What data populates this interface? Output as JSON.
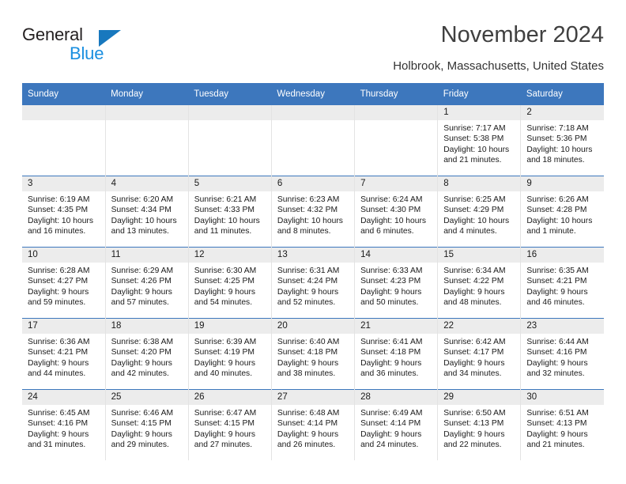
{
  "brand": {
    "name_part1": "General",
    "name_part2": "Blue",
    "triangle_color": "#1878be",
    "blue_color": "#1a8fe0"
  },
  "header": {
    "title": "November 2024",
    "location": "Holbrook, Massachusetts, United States"
  },
  "theme": {
    "header_blue": "#3d77bd",
    "daynum_gray": "#ececec",
    "grid_line": "#e3e3e3"
  },
  "weekday_headers": [
    "Sunday",
    "Monday",
    "Tuesday",
    "Wednesday",
    "Thursday",
    "Friday",
    "Saturday"
  ],
  "weeks": [
    [
      {
        "day": "",
        "sunrise": "",
        "sunset": "",
        "daylight_line1": "",
        "daylight_line2": "",
        "empty": true
      },
      {
        "day": "",
        "sunrise": "",
        "sunset": "",
        "daylight_line1": "",
        "daylight_line2": "",
        "empty": true
      },
      {
        "day": "",
        "sunrise": "",
        "sunset": "",
        "daylight_line1": "",
        "daylight_line2": "",
        "empty": true
      },
      {
        "day": "",
        "sunrise": "",
        "sunset": "",
        "daylight_line1": "",
        "daylight_line2": "",
        "empty": true
      },
      {
        "day": "",
        "sunrise": "",
        "sunset": "",
        "daylight_line1": "",
        "daylight_line2": "",
        "empty": true
      },
      {
        "day": "1",
        "sunrise": "Sunrise: 7:17 AM",
        "sunset": "Sunset: 5:38 PM",
        "daylight_line1": "Daylight: 10 hours",
        "daylight_line2": "and 21 minutes.",
        "empty": false
      },
      {
        "day": "2",
        "sunrise": "Sunrise: 7:18 AM",
        "sunset": "Sunset: 5:36 PM",
        "daylight_line1": "Daylight: 10 hours",
        "daylight_line2": "and 18 minutes.",
        "empty": false
      }
    ],
    [
      {
        "day": "3",
        "sunrise": "Sunrise: 6:19 AM",
        "sunset": "Sunset: 4:35 PM",
        "daylight_line1": "Daylight: 10 hours",
        "daylight_line2": "and 16 minutes.",
        "empty": false
      },
      {
        "day": "4",
        "sunrise": "Sunrise: 6:20 AM",
        "sunset": "Sunset: 4:34 PM",
        "daylight_line1": "Daylight: 10 hours",
        "daylight_line2": "and 13 minutes.",
        "empty": false
      },
      {
        "day": "5",
        "sunrise": "Sunrise: 6:21 AM",
        "sunset": "Sunset: 4:33 PM",
        "daylight_line1": "Daylight: 10 hours",
        "daylight_line2": "and 11 minutes.",
        "empty": false
      },
      {
        "day": "6",
        "sunrise": "Sunrise: 6:23 AM",
        "sunset": "Sunset: 4:32 PM",
        "daylight_line1": "Daylight: 10 hours",
        "daylight_line2": "and 8 minutes.",
        "empty": false
      },
      {
        "day": "7",
        "sunrise": "Sunrise: 6:24 AM",
        "sunset": "Sunset: 4:30 PM",
        "daylight_line1": "Daylight: 10 hours",
        "daylight_line2": "and 6 minutes.",
        "empty": false
      },
      {
        "day": "8",
        "sunrise": "Sunrise: 6:25 AM",
        "sunset": "Sunset: 4:29 PM",
        "daylight_line1": "Daylight: 10 hours",
        "daylight_line2": "and 4 minutes.",
        "empty": false
      },
      {
        "day": "9",
        "sunrise": "Sunrise: 6:26 AM",
        "sunset": "Sunset: 4:28 PM",
        "daylight_line1": "Daylight: 10 hours",
        "daylight_line2": "and 1 minute.",
        "empty": false
      }
    ],
    [
      {
        "day": "10",
        "sunrise": "Sunrise: 6:28 AM",
        "sunset": "Sunset: 4:27 PM",
        "daylight_line1": "Daylight: 9 hours",
        "daylight_line2": "and 59 minutes.",
        "empty": false
      },
      {
        "day": "11",
        "sunrise": "Sunrise: 6:29 AM",
        "sunset": "Sunset: 4:26 PM",
        "daylight_line1": "Daylight: 9 hours",
        "daylight_line2": "and 57 minutes.",
        "empty": false
      },
      {
        "day": "12",
        "sunrise": "Sunrise: 6:30 AM",
        "sunset": "Sunset: 4:25 PM",
        "daylight_line1": "Daylight: 9 hours",
        "daylight_line2": "and 54 minutes.",
        "empty": false
      },
      {
        "day": "13",
        "sunrise": "Sunrise: 6:31 AM",
        "sunset": "Sunset: 4:24 PM",
        "daylight_line1": "Daylight: 9 hours",
        "daylight_line2": "and 52 minutes.",
        "empty": false
      },
      {
        "day": "14",
        "sunrise": "Sunrise: 6:33 AM",
        "sunset": "Sunset: 4:23 PM",
        "daylight_line1": "Daylight: 9 hours",
        "daylight_line2": "and 50 minutes.",
        "empty": false
      },
      {
        "day": "15",
        "sunrise": "Sunrise: 6:34 AM",
        "sunset": "Sunset: 4:22 PM",
        "daylight_line1": "Daylight: 9 hours",
        "daylight_line2": "and 48 minutes.",
        "empty": false
      },
      {
        "day": "16",
        "sunrise": "Sunrise: 6:35 AM",
        "sunset": "Sunset: 4:21 PM",
        "daylight_line1": "Daylight: 9 hours",
        "daylight_line2": "and 46 minutes.",
        "empty": false
      }
    ],
    [
      {
        "day": "17",
        "sunrise": "Sunrise: 6:36 AM",
        "sunset": "Sunset: 4:21 PM",
        "daylight_line1": "Daylight: 9 hours",
        "daylight_line2": "and 44 minutes.",
        "empty": false
      },
      {
        "day": "18",
        "sunrise": "Sunrise: 6:38 AM",
        "sunset": "Sunset: 4:20 PM",
        "daylight_line1": "Daylight: 9 hours",
        "daylight_line2": "and 42 minutes.",
        "empty": false
      },
      {
        "day": "19",
        "sunrise": "Sunrise: 6:39 AM",
        "sunset": "Sunset: 4:19 PM",
        "daylight_line1": "Daylight: 9 hours",
        "daylight_line2": "and 40 minutes.",
        "empty": false
      },
      {
        "day": "20",
        "sunrise": "Sunrise: 6:40 AM",
        "sunset": "Sunset: 4:18 PM",
        "daylight_line1": "Daylight: 9 hours",
        "daylight_line2": "and 38 minutes.",
        "empty": false
      },
      {
        "day": "21",
        "sunrise": "Sunrise: 6:41 AM",
        "sunset": "Sunset: 4:18 PM",
        "daylight_line1": "Daylight: 9 hours",
        "daylight_line2": "and 36 minutes.",
        "empty": false
      },
      {
        "day": "22",
        "sunrise": "Sunrise: 6:42 AM",
        "sunset": "Sunset: 4:17 PM",
        "daylight_line1": "Daylight: 9 hours",
        "daylight_line2": "and 34 minutes.",
        "empty": false
      },
      {
        "day": "23",
        "sunrise": "Sunrise: 6:44 AM",
        "sunset": "Sunset: 4:16 PM",
        "daylight_line1": "Daylight: 9 hours",
        "daylight_line2": "and 32 minutes.",
        "empty": false
      }
    ],
    [
      {
        "day": "24",
        "sunrise": "Sunrise: 6:45 AM",
        "sunset": "Sunset: 4:16 PM",
        "daylight_line1": "Daylight: 9 hours",
        "daylight_line2": "and 31 minutes.",
        "empty": false
      },
      {
        "day": "25",
        "sunrise": "Sunrise: 6:46 AM",
        "sunset": "Sunset: 4:15 PM",
        "daylight_line1": "Daylight: 9 hours",
        "daylight_line2": "and 29 minutes.",
        "empty": false
      },
      {
        "day": "26",
        "sunrise": "Sunrise: 6:47 AM",
        "sunset": "Sunset: 4:15 PM",
        "daylight_line1": "Daylight: 9 hours",
        "daylight_line2": "and 27 minutes.",
        "empty": false
      },
      {
        "day": "27",
        "sunrise": "Sunrise: 6:48 AM",
        "sunset": "Sunset: 4:14 PM",
        "daylight_line1": "Daylight: 9 hours",
        "daylight_line2": "and 26 minutes.",
        "empty": false
      },
      {
        "day": "28",
        "sunrise": "Sunrise: 6:49 AM",
        "sunset": "Sunset: 4:14 PM",
        "daylight_line1": "Daylight: 9 hours",
        "daylight_line2": "and 24 minutes.",
        "empty": false
      },
      {
        "day": "29",
        "sunrise": "Sunrise: 6:50 AM",
        "sunset": "Sunset: 4:13 PM",
        "daylight_line1": "Daylight: 9 hours",
        "daylight_line2": "and 22 minutes.",
        "empty": false
      },
      {
        "day": "30",
        "sunrise": "Sunrise: 6:51 AM",
        "sunset": "Sunset: 4:13 PM",
        "daylight_line1": "Daylight: 9 hours",
        "daylight_line2": "and 21 minutes.",
        "empty": false
      }
    ]
  ]
}
